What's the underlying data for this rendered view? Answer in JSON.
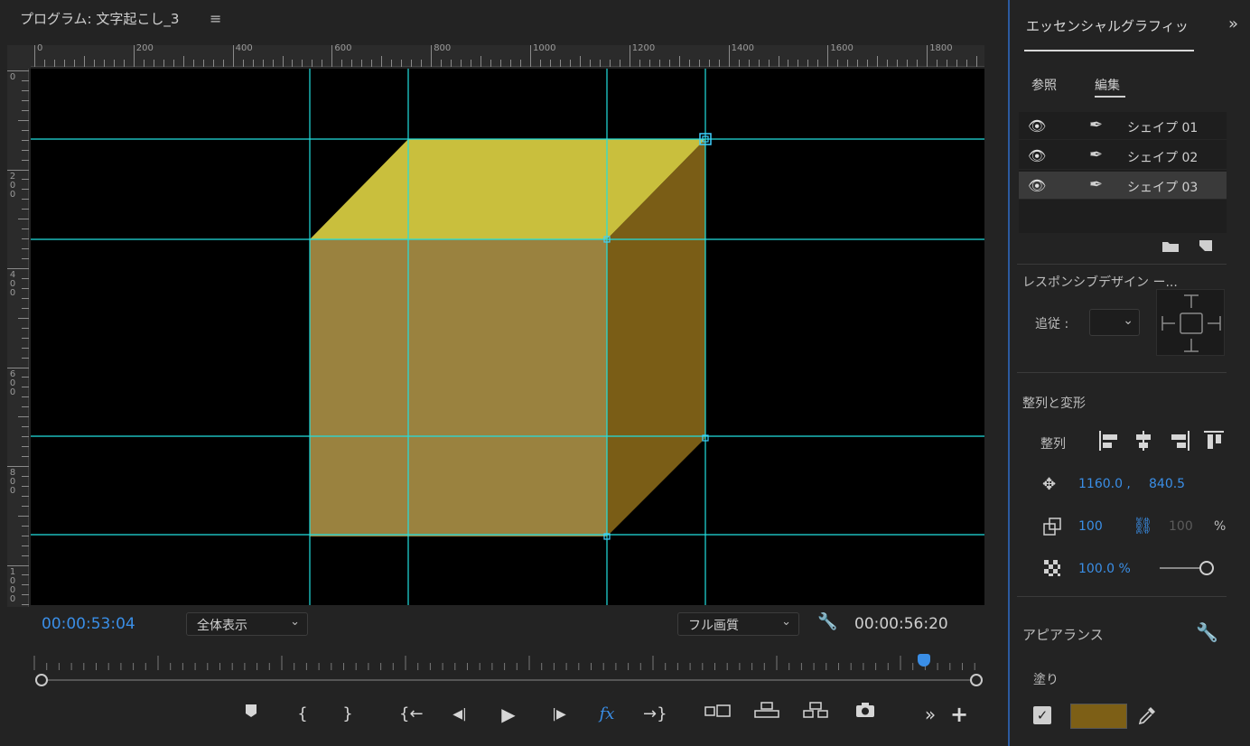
{
  "monitor": {
    "title": "プログラム: 文字起こし_3",
    "menu_icon": "≡",
    "ruler_h_labels": [
      "0",
      "200",
      "400",
      "600",
      "800",
      "1000",
      "1200",
      "1400",
      "1600",
      "1800"
    ],
    "ruler_v_labels": [
      "0",
      "200",
      "400",
      "600",
      "800",
      "1000"
    ],
    "timecode_current": "00:00:53:04",
    "timecode_duration": "00:00:56:20",
    "zoom_select": "全体表示",
    "quality_select": "フル画質"
  },
  "canvas": {
    "shape_colors": {
      "top_face": "#c9bf3d",
      "front_face": "#9a823f",
      "side_face": "#7a5d16",
      "guide_color": "#22e0e0"
    }
  },
  "transport": {
    "buttons": [
      {
        "name": "add-marker-button",
        "icon": "marker-icon"
      },
      {
        "name": "mark-in-button",
        "label": "{"
      },
      {
        "name": "mark-out-button",
        "label": "}"
      },
      {
        "name": "go-to-in-button",
        "label": "{←"
      },
      {
        "name": "step-back-button",
        "label": "◀|"
      },
      {
        "name": "play-button",
        "label": "▶"
      },
      {
        "name": "step-forward-button",
        "label": "|▶"
      },
      {
        "name": "fx-button",
        "label": "fx"
      },
      {
        "name": "go-to-out-button",
        "label": "→}"
      },
      {
        "name": "safe-margins-button",
        "icon": "safe-margin-icon"
      },
      {
        "name": "lift-button",
        "icon": "lift-icon"
      },
      {
        "name": "extract-button",
        "icon": "extract-icon"
      },
      {
        "name": "export-frame-button",
        "icon": "camera-icon"
      },
      {
        "name": "more-button",
        "label": "»"
      },
      {
        "name": "add-button",
        "label": "+"
      }
    ],
    "playhead_fraction": 0.943
  },
  "essential_graphics": {
    "title": "エッセンシャルグラフィッ",
    "expand_icon": "»",
    "tabs": [
      "参照",
      "編集"
    ],
    "active_tab": "編集",
    "layers": [
      {
        "name": "シェイプ 01",
        "selected": false
      },
      {
        "name": "シェイプ 02",
        "selected": false
      },
      {
        "name": "シェイプ 03",
        "selected": true
      }
    ],
    "responsive_label": "レスポンシブデザイン ー...",
    "follow_label": "追従 :",
    "align_section_label": "整列と変形",
    "align_label": "整列",
    "position_x": "1160.0 ,",
    "position_y": "840.5",
    "scale": "100",
    "scale_linked": "100",
    "scale_unit": "%",
    "opacity": "100.0 %",
    "opacity_fraction": 1.0,
    "appearance_label": "アピアランス",
    "fill_label": "塗り",
    "fill_checked": true,
    "fill_color": "#7d5f16"
  }
}
